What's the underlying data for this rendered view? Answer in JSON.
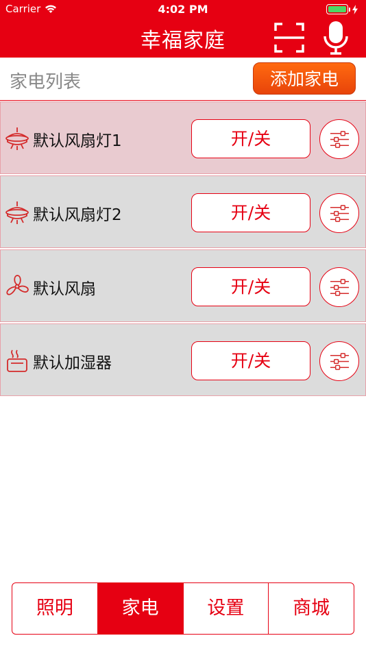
{
  "status_bar": {
    "carrier": "Carrier",
    "time": "4:02 PM",
    "battery_level": 1.0
  },
  "header": {
    "title": "幸福家庭",
    "scan_icon": "scan-icon",
    "mic_icon": "microphone-icon"
  },
  "toolbar": {
    "title": "家电列表",
    "add_label": "添加家电"
  },
  "devices": [
    {
      "name": "默认风扇灯1",
      "icon": "fan-light-icon",
      "toggle_label": "开/关",
      "selected": true
    },
    {
      "name": "默认风扇灯2",
      "icon": "fan-light-icon",
      "toggle_label": "开/关",
      "selected": false
    },
    {
      "name": "默认风扇",
      "icon": "fan-icon",
      "toggle_label": "开/关",
      "selected": false
    },
    {
      "name": "默认加湿器",
      "icon": "humidifier-icon",
      "toggle_label": "开/关",
      "selected": false
    }
  ],
  "tabs": [
    {
      "label": "照明",
      "active": false
    },
    {
      "label": "家电",
      "active": true
    },
    {
      "label": "设置",
      "active": false
    },
    {
      "label": "商城",
      "active": false
    }
  ],
  "colors": {
    "brand_red": "#e60012",
    "add_orange": "#f25a0e",
    "row_bg": "#dcdcdc",
    "row_selected_bg": "#e9cbd0",
    "battery_green": "#4cd964"
  }
}
